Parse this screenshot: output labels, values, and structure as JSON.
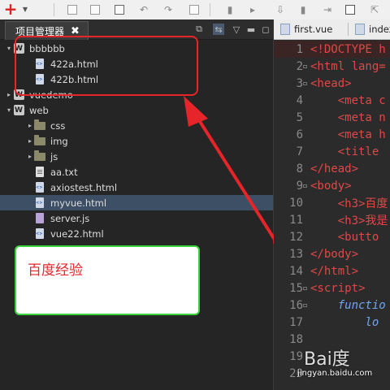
{
  "toolbar": {
    "icons": [
      "plus-icon",
      "dropdown-icon",
      "save-icon",
      "save-all-icon",
      "print-icon",
      "undo-icon",
      "redo-icon",
      "copy-icon",
      "bookmark-icon",
      "next-icon",
      "download-icon",
      "bookmark2-icon",
      "indent-icon",
      "share-icon"
    ]
  },
  "explorer": {
    "tab_label": "项目管理器",
    "close_glyph": "✖",
    "items": [
      {
        "label": "bbbbbb",
        "kind": "project",
        "expanded": true,
        "depth": 0
      },
      {
        "label": "422a.html",
        "kind": "html",
        "depth": 1
      },
      {
        "label": "422b.html",
        "kind": "html",
        "depth": 1
      },
      {
        "label": "vuedemo",
        "kind": "project",
        "expanded": false,
        "depth": 0
      },
      {
        "label": "web",
        "kind": "project",
        "expanded": true,
        "depth": 0
      },
      {
        "label": "css",
        "kind": "folder",
        "expanded": false,
        "depth": 1
      },
      {
        "label": "img",
        "kind": "folder",
        "expanded": false,
        "depth": 1
      },
      {
        "label": "js",
        "kind": "folder",
        "expanded": false,
        "depth": 1
      },
      {
        "label": "aa.txt",
        "kind": "txt",
        "depth": 1
      },
      {
        "label": "axiostest.html",
        "kind": "html",
        "depth": 1
      },
      {
        "label": "myvue.html",
        "kind": "html",
        "depth": 1,
        "selected": true
      },
      {
        "label": "server.js",
        "kind": "js",
        "depth": 1
      },
      {
        "label": "vue22.html",
        "kind": "html",
        "depth": 1
      }
    ]
  },
  "annotation": {
    "note_text": "百度经验",
    "colors": {
      "box": "#e5252a",
      "note_border": "#39d33c"
    }
  },
  "editor": {
    "tabs": [
      {
        "label": "first.vue"
      },
      {
        "label": "index"
      }
    ],
    "lines": [
      {
        "n": "1",
        "fold": "",
        "text": "<!DOCTYPE h"
      },
      {
        "n": "2",
        "fold": "◻",
        "text": "<html lang="
      },
      {
        "n": "3",
        "fold": "◻",
        "text": "<head>"
      },
      {
        "n": "4",
        "fold": "",
        "text": "    <meta c"
      },
      {
        "n": "5",
        "fold": "",
        "text": "    <meta n"
      },
      {
        "n": "6",
        "fold": "",
        "text": "    <meta h"
      },
      {
        "n": "7",
        "fold": "",
        "text": "    <title"
      },
      {
        "n": "8",
        "fold": "",
        "text": "</head>"
      },
      {
        "n": "9",
        "fold": "◻",
        "text": "<body>"
      },
      {
        "n": "10",
        "fold": "",
        "text": "    <h3>百度"
      },
      {
        "n": "11",
        "fold": "",
        "text": "    <h3>我是"
      },
      {
        "n": "12",
        "fold": "",
        "text": "    <butto"
      },
      {
        "n": "13",
        "fold": "",
        "text": "</body>"
      },
      {
        "n": "14",
        "fold": "",
        "text": "</html>"
      },
      {
        "n": "15",
        "fold": "◻",
        "text": "<script>"
      },
      {
        "n": "16",
        "fold": "◻",
        "text": "    functio"
      },
      {
        "n": "17",
        "fold": "",
        "text": "        lo"
      },
      {
        "n": "18",
        "fold": "",
        "text": ""
      },
      {
        "n": "19",
        "fold": "",
        "text": ""
      },
      {
        "n": "20",
        "fold": "",
        "text": ""
      }
    ]
  },
  "watermark": {
    "logo": "Bai度",
    "url": "jingyan.baidu.com"
  }
}
